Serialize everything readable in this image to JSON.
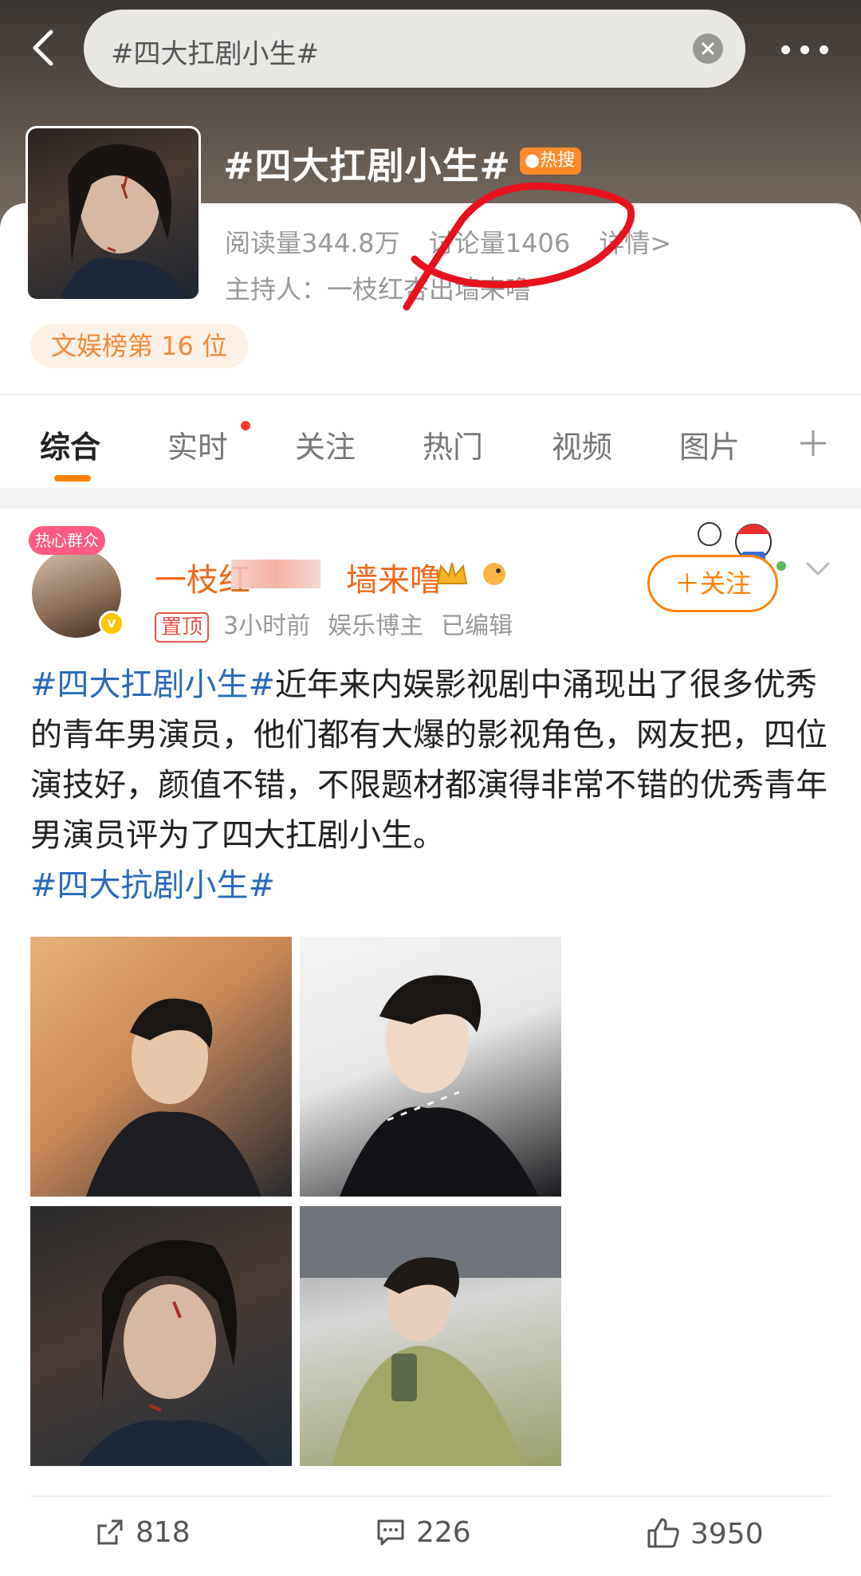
{
  "header": {
    "search_query": "#四大扛剧小生#",
    "back": "back-icon",
    "more": "more-icon"
  },
  "topic": {
    "title": "#四大扛剧小生#",
    "hot_badge": "热搜",
    "reads": "阅读量344.8万",
    "discussions": "讨论量1406",
    "details": "详情>",
    "host": "主持人：一枝红杏出墙来噜",
    "rank": "文娱榜第 16 位"
  },
  "tabs": [
    {
      "label": "综合",
      "active": true
    },
    {
      "label": "实时"
    },
    {
      "label": "关注"
    },
    {
      "label": "热门"
    },
    {
      "label": "视频"
    },
    {
      "label": "图片"
    }
  ],
  "post": {
    "avatar_tag": "热心群众",
    "username_start": "一枝红",
    "username_end": "墙来噜",
    "pinned": "置顶",
    "time": "3小时前",
    "role": "娱乐博主",
    "edited": "已编辑",
    "follow": "＋关注",
    "hashtag_lead": "#四大扛剧小生#",
    "body": "近年来内娱影视剧中涌现出了很多优秀的青年男演员，他们都有大爆的影视角色，网友把，四位演技好，颜值不错，不限题材都演得非常不错的优秀青年男演员评为了四大扛剧小生。",
    "hashtag_tail": "#四大抗剧小生#"
  },
  "actions": {
    "share": "818",
    "comment": "226",
    "like": "3950"
  },
  "colors": {
    "accent": "#ff8200",
    "hashtag": "#2a6bb8",
    "username": "#f06a1a"
  }
}
